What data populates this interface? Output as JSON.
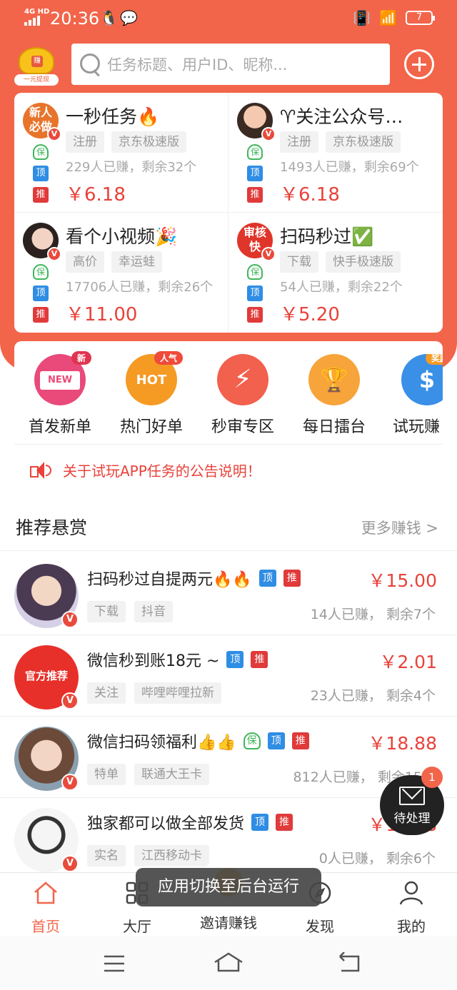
{
  "status_bar": {
    "network": "4G HD",
    "time": "20:36",
    "battery": "7"
  },
  "header": {
    "logo_caption": "一元提现",
    "logo_mark": "赚",
    "search_placeholder": "任务标题、用户ID、昵称..."
  },
  "featured": [
    {
      "title": "一秒任务🔥",
      "avatar_text": "新人必做",
      "tags": [
        "注册",
        "京东极速版"
      ],
      "stat": "229人已赚，剩余32个",
      "price": "￥6.18"
    },
    {
      "title": "♈关注公众号…",
      "avatar_text": "",
      "tags": [
        "注册",
        "京东极速版"
      ],
      "stat": "1493人已赚，剩余69个",
      "price": "￥6.18"
    },
    {
      "title": "看个小视频🎉",
      "avatar_text": "",
      "tags": [
        "高价",
        "幸运蛙"
      ],
      "stat": "17706人已赚，剩余26个",
      "price": "￥11.00"
    },
    {
      "title": "扫码秒过✅",
      "avatar_text": "审核快",
      "tags": [
        "下载",
        "快手极速版"
      ],
      "stat": "54人已赚，剩余22个",
      "price": "￥5.20"
    }
  ],
  "badges": {
    "bao": "保",
    "ding": "顶",
    "tui": "推",
    "v": "V"
  },
  "categories": [
    {
      "label": "首发新单",
      "icon_text": "NEW",
      "badge": "新",
      "color": "#e94a7a"
    },
    {
      "label": "热门好单",
      "icon_text": "HOT",
      "badge": "人气",
      "color": "#f59a23"
    },
    {
      "label": "秒审专区",
      "icon_text": "⚡",
      "badge": "",
      "color": "#f2604e"
    },
    {
      "label": "每日擂台",
      "icon_text": "🏆",
      "badge": "",
      "color": "#f7a43a"
    },
    {
      "label": "试玩赚",
      "icon_text": "$",
      "badge": "奖励",
      "color": "#3a8fe6"
    }
  ],
  "notice": "关于试玩APP任务的公告说明！",
  "section": {
    "title": "推荐悬赏",
    "more": "更多赚钱 >"
  },
  "tasks": [
    {
      "title": "扫码秒过自提两元🔥🔥",
      "price": "￥15.00",
      "tags": [
        "下载",
        "抖音"
      ],
      "stat": "14人已赚，  剩余7个",
      "avatar_text": ""
    },
    {
      "title": "微信秒到账18元 ~",
      "price": "￥2.01",
      "tags": [
        "关注",
        "哔哩哔哩拉新"
      ],
      "stat": "23人已赚，  剩余4个",
      "avatar_text": "官方推荐"
    },
    {
      "title": "微信扫码领福利👍👍",
      "price": "￥18.88",
      "tags": [
        "特单",
        "联通大王卡"
      ],
      "stat": "812人已赚，  剩余15个",
      "avatar_text": ""
    },
    {
      "title": "独家都可以做全部发货",
      "price": "￥12.88",
      "tags": [
        "实名",
        "江西移动卡"
      ],
      "stat": "0人已赚，  剩余6个",
      "avatar_text": ""
    }
  ],
  "pending": {
    "label": "待处理",
    "count": "1"
  },
  "tabs": [
    {
      "label": "首页",
      "icon": "home-icon"
    },
    {
      "label": "大厅",
      "icon": "grid-icon"
    },
    {
      "label": "邀请赚钱",
      "icon": "coin-icon"
    },
    {
      "label": "发现",
      "icon": "compass-icon"
    },
    {
      "label": "我的",
      "icon": "user-icon"
    }
  ],
  "toast": "应用切换至后台运行",
  "colors": {
    "brand": "#f2654a",
    "price": "#e8423a",
    "ding": "#2f8de4",
    "tui": "#e03a3a",
    "bao": "#3fb65a"
  }
}
